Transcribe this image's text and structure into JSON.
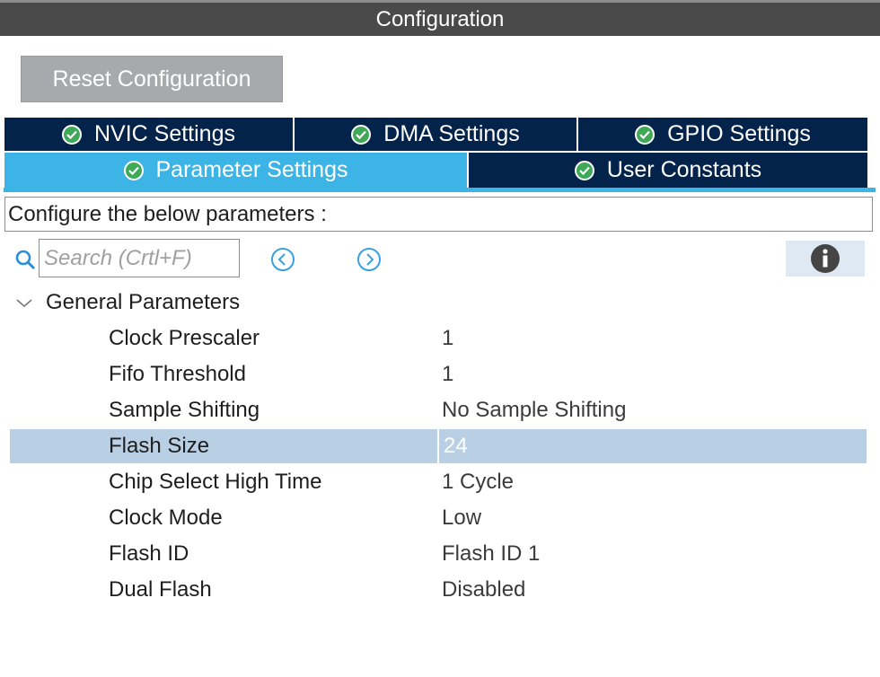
{
  "window": {
    "title": "Configuration"
  },
  "toolbar": {
    "reset_label": "Reset Configuration"
  },
  "tabs": {
    "row1": [
      {
        "label": "NVIC Settings",
        "status": "ok"
      },
      {
        "label": "DMA Settings",
        "status": "ok"
      },
      {
        "label": "GPIO Settings",
        "status": "ok"
      }
    ],
    "row2": [
      {
        "label": "Parameter Settings",
        "status": "ok",
        "active": true
      },
      {
        "label": "User Constants",
        "status": "ok"
      }
    ]
  },
  "description": "Configure the below parameters :",
  "search": {
    "placeholder": "Search (Crtl+F)",
    "value": ""
  },
  "icons": {
    "search": "search-icon",
    "prev": "chevron-left-circle-icon",
    "next": "chevron-right-circle-icon",
    "info": "info-icon",
    "check": "check-circle-icon",
    "collapse": "chevron-down-icon"
  },
  "colors": {
    "tab_inactive": "#03234b",
    "tab_active": "#3cb4e6",
    "check": "#3fa958",
    "selected_row": "#b8cfe4",
    "title_bar": "#4a4a4a"
  },
  "group": {
    "label": "General Parameters",
    "expanded": true,
    "params": [
      {
        "name": "Clock Prescaler",
        "value": "1"
      },
      {
        "name": "Fifo Threshold",
        "value": "1"
      },
      {
        "name": "Sample Shifting",
        "value": "No Sample Shifting"
      },
      {
        "name": "Flash Size",
        "value": "24",
        "selected": true
      },
      {
        "name": "Chip Select High Time",
        "value": "1 Cycle"
      },
      {
        "name": "Clock Mode",
        "value": "Low"
      },
      {
        "name": "Flash ID",
        "value": "Flash ID 1"
      },
      {
        "name": "Dual Flash",
        "value": "Disabled"
      }
    ]
  }
}
